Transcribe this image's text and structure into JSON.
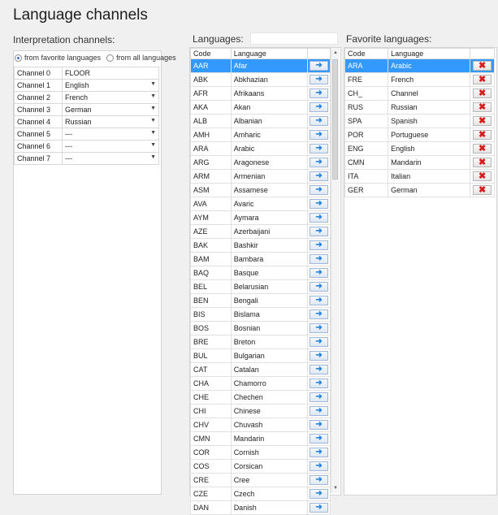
{
  "title": "Language channels",
  "interpretation": {
    "label": "Interpretation channels:",
    "radio_favorite": "from favorite languages",
    "radio_all": "from all languages",
    "channels": [
      {
        "name": "Channel 0",
        "value": "FLOOR",
        "dropdown": false
      },
      {
        "name": "Channel 1",
        "value": "English",
        "dropdown": true
      },
      {
        "name": "Channel 2",
        "value": "French",
        "dropdown": true
      },
      {
        "name": "Channel 3",
        "value": "German",
        "dropdown": true
      },
      {
        "name": "Channel 4",
        "value": "Russian",
        "dropdown": true
      },
      {
        "name": "Channel 5",
        "value": "---",
        "dropdown": true
      },
      {
        "name": "Channel 6",
        "value": "---",
        "dropdown": true
      },
      {
        "name": "Channel 7",
        "value": "---",
        "dropdown": true
      }
    ]
  },
  "languages": {
    "label": "Languages:",
    "search_value": "",
    "col_code": "Code",
    "col_language": "Language",
    "rows": [
      [
        "AAR",
        "Afar"
      ],
      [
        "ABK",
        "Abkhazian"
      ],
      [
        "AFR",
        "Afrikaans"
      ],
      [
        "AKA",
        "Akan"
      ],
      [
        "ALB",
        "Albanian"
      ],
      [
        "AMH",
        "Amharic"
      ],
      [
        "ARA",
        "Arabic"
      ],
      [
        "ARG",
        "Aragonese"
      ],
      [
        "ARM",
        "Armenian"
      ],
      [
        "ASM",
        "Assamese"
      ],
      [
        "AVA",
        "Avaric"
      ],
      [
        "AYM",
        "Aymara"
      ],
      [
        "AZE",
        "Azerbaijani"
      ],
      [
        "BAK",
        "Bashkir"
      ],
      [
        "BAM",
        "Bambara"
      ],
      [
        "BAQ",
        "Basque"
      ],
      [
        "BEL",
        "Belarusian"
      ],
      [
        "BEN",
        "Bengali"
      ],
      [
        "BIS",
        "Bislama"
      ],
      [
        "BOS",
        "Bosnian"
      ],
      [
        "BRE",
        "Breton"
      ],
      [
        "BUL",
        "Bulgarian"
      ],
      [
        "CAT",
        "Catalan"
      ],
      [
        "CHA",
        "Chamorro"
      ],
      [
        "CHE",
        "Chechen"
      ],
      [
        "CHI",
        "Chinese"
      ],
      [
        "CHV",
        "Chuvash"
      ],
      [
        "CMN",
        "Mandarin"
      ],
      [
        "COR",
        "Cornish"
      ],
      [
        "COS",
        "Corsican"
      ],
      [
        "CRE",
        "Cree"
      ],
      [
        "CZE",
        "Czech"
      ],
      [
        "DAN",
        "Danish"
      ]
    ]
  },
  "favorites": {
    "label": "Favorite languages:",
    "col_code": "Code",
    "col_language": "Language",
    "rows": [
      [
        "ARA",
        "Arabic"
      ],
      [
        "FRE",
        "French"
      ],
      [
        "CH_",
        "Channel"
      ],
      [
        "RUS",
        "Russian"
      ],
      [
        "SPA",
        "Spanish"
      ],
      [
        "POR",
        "Portuguese"
      ],
      [
        "ENG",
        "English"
      ],
      [
        "CMN",
        "Mandarin"
      ],
      [
        "ITA",
        "Italian"
      ],
      [
        "GER",
        "German"
      ]
    ]
  },
  "icons": {
    "add": "arrow-right-icon",
    "remove": "delete-x-icon"
  },
  "colors": {
    "selection": "#3399ff",
    "add_arrow": "#2a84d8",
    "remove_x": "#d41e1e"
  }
}
